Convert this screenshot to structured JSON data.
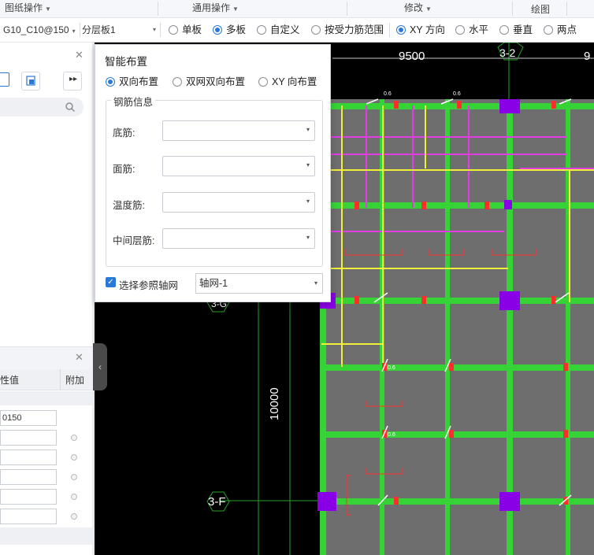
{
  "ribbon": {
    "groups": [
      "图纸操作",
      "通用操作",
      "修改",
      "绘图"
    ]
  },
  "toolbar": {
    "rebar_combo": "G10_C10@150",
    "layer_combo": "分层板1",
    "placement_modes": [
      {
        "label": "单板",
        "checked": false
      },
      {
        "label": "多板",
        "checked": true
      },
      {
        "label": "自定义",
        "checked": false
      },
      {
        "label": "按受力筋范围",
        "checked": false
      }
    ],
    "direction_modes": [
      {
        "label": "XY 方向",
        "checked": true
      },
      {
        "label": "水平",
        "checked": false
      },
      {
        "label": "垂直",
        "checked": false
      },
      {
        "label": "两点",
        "checked": false
      }
    ]
  },
  "left_panel": {
    "prop_columns": [
      "性值",
      "附加"
    ],
    "prop_first_value": "0150"
  },
  "dialog": {
    "title": "智能布置",
    "layout_options": [
      {
        "label": "双向布置",
        "checked": true
      },
      {
        "label": "双网双向布置",
        "checked": false
      },
      {
        "label": "XY 向布置",
        "checked": false
      }
    ],
    "rebar_group_label": "钢筋信息",
    "fields": [
      {
        "label": "底筋:",
        "value": ""
      },
      {
        "label": "面筋:",
        "value": ""
      },
      {
        "label": "温度筋:",
        "value": ""
      },
      {
        "label": "中间层筋:",
        "value": ""
      }
    ],
    "ref_axis": {
      "label": "选择参照轴网",
      "checked": true,
      "value": "轴网-1"
    }
  },
  "canvas": {
    "dim_top": "9500",
    "dim_top_right": "9",
    "axis_top": "3-2",
    "dim_side": "10000",
    "axis_left": "3-F",
    "axis_left_partial": "3-G",
    "rebar_tag": "0.6",
    "colors": {
      "background": "#000000",
      "slab": "#6e6e6e",
      "beam": "#35d335",
      "column": "#8a00e6",
      "rebar_magenta": "#e23de2",
      "rebar_yellow": "#f0f03c",
      "annotation_red": "#ff2d2d",
      "arrow": "#e53b3b"
    }
  }
}
